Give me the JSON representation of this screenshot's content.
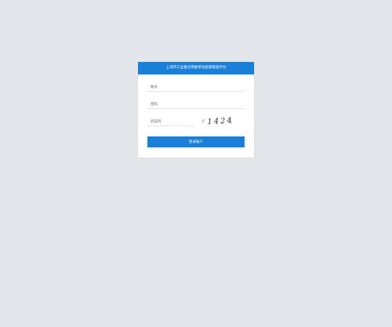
{
  "header": {
    "title": "上海市工业重点用能单位能源管理平台"
  },
  "form": {
    "account_placeholder": "账号",
    "password_placeholder": "密码",
    "captcha_placeholder": "验证码",
    "captcha_text": "1424"
  },
  "actions": {
    "login_label": "登录账户"
  },
  "colors": {
    "primary": "#1a7fd8",
    "background": "#e3e6ea",
    "card": "#ffffff"
  }
}
